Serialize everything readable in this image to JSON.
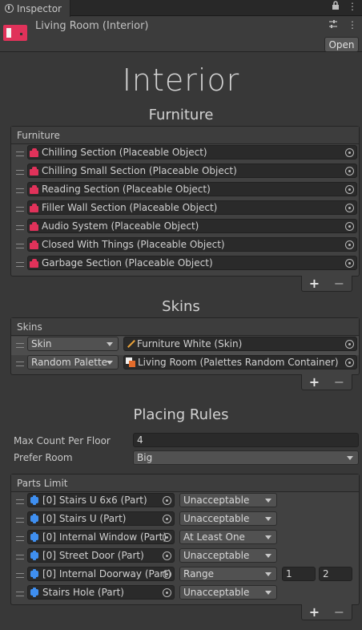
{
  "tab": {
    "title": "Inspector"
  },
  "header": {
    "asset_title": "Living Room (Interior)",
    "open_label": "Open"
  },
  "main_title": "Interior",
  "furniture": {
    "section_title": "Furniture",
    "list_header": "Furniture",
    "items": [
      "Chilling Section (Placeable Object)",
      "Chilling Small Section (Placeable Object)",
      "Reading Section (Placeable Object)",
      "Filler Wall Section (Placeable Object)",
      "Audio System (Placeable Object)",
      "Closed With Things (Placeable Object)",
      "Garbage Section (Placeable Object)"
    ]
  },
  "skins": {
    "section_title": "Skins",
    "list_header": "Skins",
    "items": [
      {
        "type": "Skin",
        "value": "Furniture White (Skin)"
      },
      {
        "type": "Random Palette",
        "value": "Living Room (Palettes Random Container)"
      }
    ]
  },
  "placing_rules": {
    "section_title": "Placing Rules",
    "max_count_label": "Max Count Per Floor",
    "max_count_value": "4",
    "prefer_room_label": "Prefer Room",
    "prefer_room_value": "Big"
  },
  "parts_limit": {
    "list_header": "Parts Limit",
    "items": [
      {
        "part": "[0] Stairs U 6x6 (Part)",
        "rule": "Unacceptable"
      },
      {
        "part": "[0] Stairs U (Part)",
        "rule": "Unacceptable"
      },
      {
        "part": "[0] Internal Window (Part)",
        "rule": "At Least One"
      },
      {
        "part": "[0] Street Door (Part)",
        "rule": "Unacceptable"
      },
      {
        "part": "[0] Internal Doorway (Part)",
        "rule": "Range",
        "min": "1",
        "max": "2"
      },
      {
        "part": "Stairs Hole (Part)",
        "rule": "Unacceptable"
      }
    ]
  },
  "footer": {
    "add": "+",
    "remove": "−"
  }
}
